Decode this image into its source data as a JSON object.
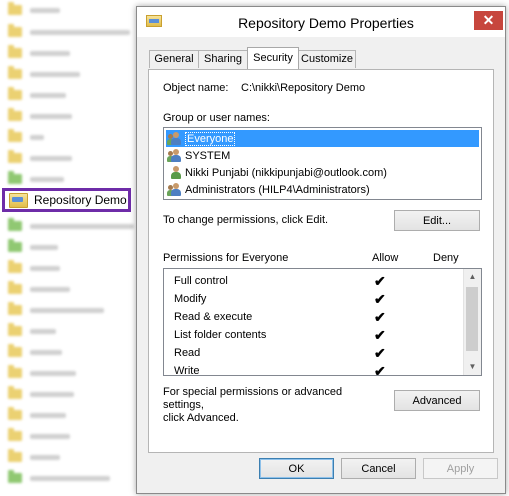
{
  "explorer": {
    "selected_folder": "Repository Demo"
  },
  "dialog": {
    "title": "Repository Demo Properties",
    "close_glyph": "✕",
    "tabs": [
      "General",
      "Sharing",
      "Security",
      "Customize"
    ],
    "active_tab": "Security",
    "object_name_label": "Object name:",
    "object_name_value": "C:\\nikki\\Repository Demo",
    "group_label": "Group or user names:",
    "users": [
      {
        "name": "Everyone",
        "icon": "group-icon"
      },
      {
        "name": "SYSTEM",
        "icon": "group-icon"
      },
      {
        "name": "Nikki Punjabi (nikkipunjabi@outlook.com)",
        "icon": "user-icon"
      },
      {
        "name": "Administrators (HILP4\\Administrators)",
        "icon": "group-icon"
      }
    ],
    "selected_user": "Everyone",
    "change_text": "To change permissions, click Edit.",
    "edit_label": "Edit...",
    "permissions_header": "Permissions for Everyone",
    "allow_header": "Allow",
    "deny_header": "Deny",
    "permissions": [
      {
        "name": "Full control",
        "allow": "✔",
        "deny": ""
      },
      {
        "name": "Modify",
        "allow": "✔",
        "deny": ""
      },
      {
        "name": "Read & execute",
        "allow": "✔",
        "deny": ""
      },
      {
        "name": "List folder contents",
        "allow": "✔",
        "deny": ""
      },
      {
        "name": "Read",
        "allow": "✔",
        "deny": ""
      },
      {
        "name": "Write",
        "allow": "✔",
        "deny": ""
      }
    ],
    "special_text_line1": "For special permissions or advanced settings,",
    "special_text_line2": "click Advanced.",
    "advanced_label": "Advanced",
    "ok_label": "OK",
    "cancel_label": "Cancel",
    "apply_label": "Apply",
    "colors": {
      "selection": "#3399ff",
      "close_button": "#c7463d",
      "highlight_border": "#6e2ca8"
    }
  }
}
